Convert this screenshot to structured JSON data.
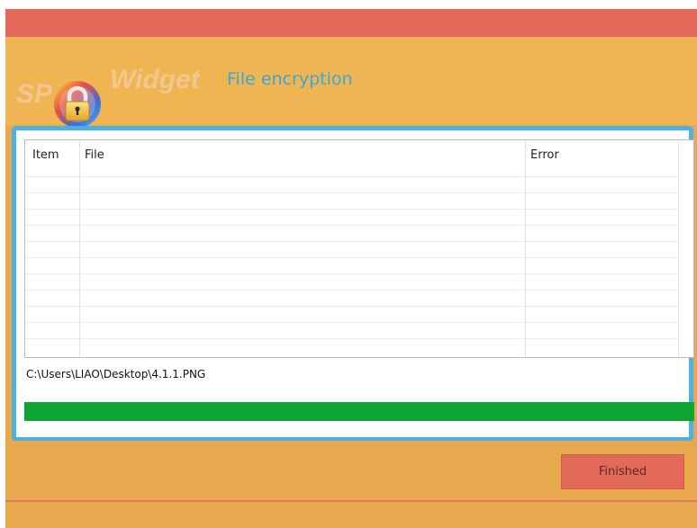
{
  "header": {
    "brand_left": "SP",
    "brand_right": "Widget",
    "title": "File encryption"
  },
  "table": {
    "columns": [
      "Item",
      "File",
      "Error"
    ],
    "rows": []
  },
  "status": {
    "current_file": "C:\\Users\\LIAO\\Desktop\\4.1.1.PNG",
    "progress_percent": 100
  },
  "actions": {
    "finished_label": "Finished"
  },
  "colors": {
    "titlebar": "#e3695b",
    "background": "#e8a84e",
    "accent_blue": "#4bb0e2",
    "progress_green": "#0da52f"
  },
  "icons": {
    "logo": "padlock-icon"
  }
}
